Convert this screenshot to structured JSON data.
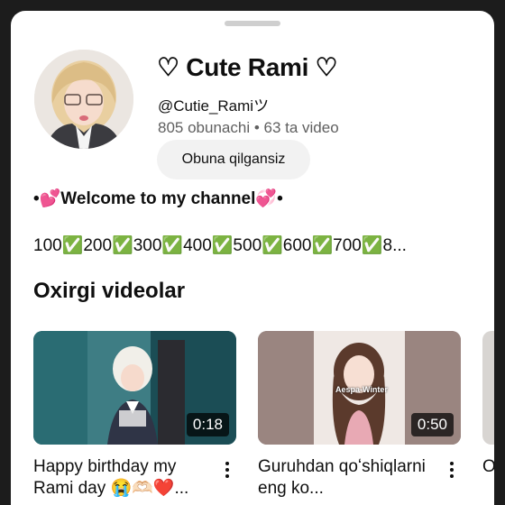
{
  "channel": {
    "title": "♡ Cute Rami ♡",
    "handle": "@Cutie_Ramiツ",
    "stats": "805 obunachi • 63 ta video",
    "subscribe_label": "Obuna qilgansiz",
    "welcome_text": "•💕Welcome to my channel💞•",
    "milestones_text": "100✅200✅300✅400✅500✅600✅700✅8..."
  },
  "videos_section": {
    "title": "Oxirgi videolar",
    "videos": [
      {
        "title": "Happy birthday my Rami day 😭🫶🏻❤️...",
        "duration": "0:18"
      },
      {
        "title": "Guruhdan qoʻshiqlarni eng ko...",
        "duration": "0:50",
        "overlay_text": "Aespa-Winter"
      },
      {
        "title": "O..."
      }
    ]
  },
  "colors": {
    "background": "#1c1c1c",
    "sheet": "#ffffff",
    "subscribe_button": "#f2f2f2",
    "secondary_text": "#606060"
  }
}
